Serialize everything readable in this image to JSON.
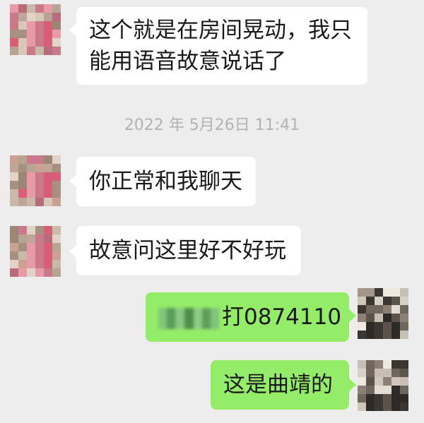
{
  "messages": [
    {
      "side": "left",
      "text_line1": "这个就是在房间晃动，我只",
      "text_line2": "能用语音故意说话了"
    },
    {
      "side": "left",
      "text": "你正常和我聊天"
    },
    {
      "side": "left",
      "text": "故意问这里好不好玩"
    },
    {
      "side": "right",
      "text": "打0874110"
    },
    {
      "side": "right",
      "text": "这是曲靖的"
    }
  ],
  "timestamp": "2022 年 5月26日 11:41",
  "colors": {
    "background": "#ededed",
    "incoming_bubble": "#ffffff",
    "outgoing_bubble": "#95ec69",
    "timestamp_text": "#b2b2b2"
  },
  "icons": {
    "contact_avatar": "pixelated-avatar-icon",
    "self_avatar": "pixelated-avatar-icon"
  }
}
